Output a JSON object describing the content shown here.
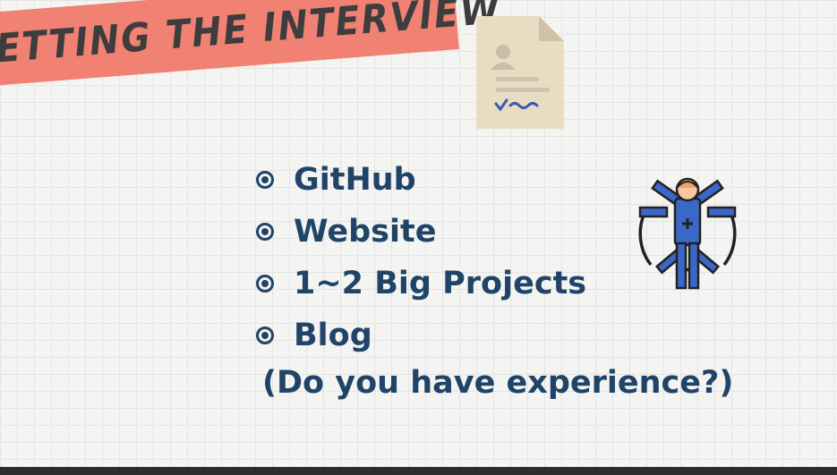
{
  "slide": {
    "banner_title": "GETTING THE INTERVIEW",
    "bullets": [
      {
        "label": "GitHub"
      },
      {
        "label": "Website"
      },
      {
        "label": "1~2 Big Projects"
      },
      {
        "label": "Blog"
      }
    ],
    "question": "(Do you have experience?)"
  },
  "icons": {
    "document": "resume-document-icon",
    "figure": "vitruvian-man-icon"
  },
  "colors": {
    "banner": "#f08173",
    "text": "#1f4468",
    "document": "#e8dcc3",
    "figure_blue": "#3a67c8"
  }
}
